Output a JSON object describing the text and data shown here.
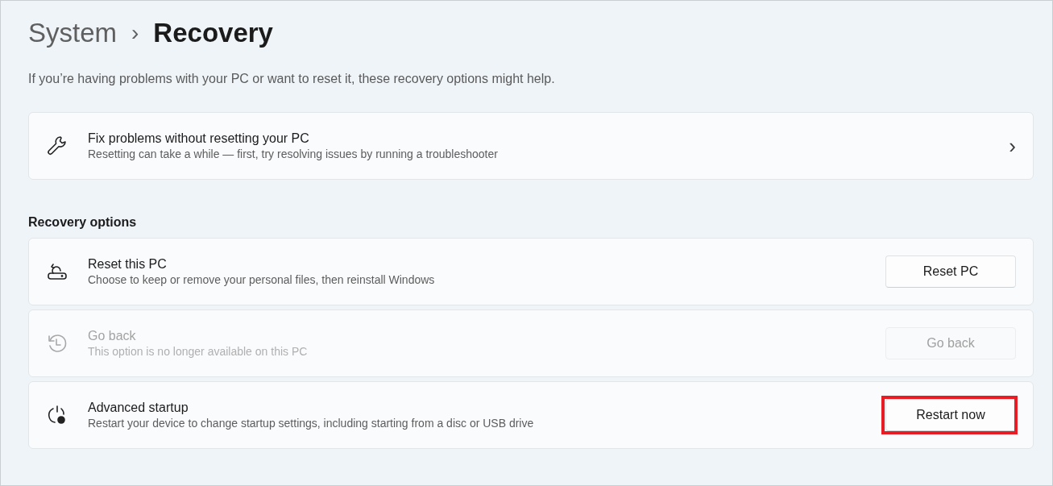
{
  "breadcrumb": [
    {
      "label": "System",
      "current": false
    },
    {
      "label": "Recovery",
      "current": true
    }
  ],
  "breadcrumb_separator": "›",
  "description": "If you’re having problems with your PC or want to reset it, these recovery options might help.",
  "fix_card": {
    "kind": "wrench",
    "title": "Fix problems without resetting your PC",
    "subtitle": "Resetting can take a while — first, try resolving issues by running a troubleshooter",
    "chevron": "›"
  },
  "section_title": "Recovery options",
  "options": [
    {
      "kind": "reset",
      "title": "Reset this PC",
      "subtitle": "Choose to keep or remove your personal files, then reinstall Windows",
      "button": "Reset PC",
      "disabled": false,
      "highlighted": false
    },
    {
      "kind": "history",
      "title": "Go back",
      "subtitle": "This option is no longer available on this PC",
      "button": "Go back",
      "disabled": true,
      "highlighted": false
    },
    {
      "kind": "startup",
      "title": "Advanced startup",
      "subtitle": "Restart your device to change startup settings, including starting from a disc or USB drive",
      "button": "Restart now",
      "disabled": false,
      "highlighted": true
    }
  ]
}
